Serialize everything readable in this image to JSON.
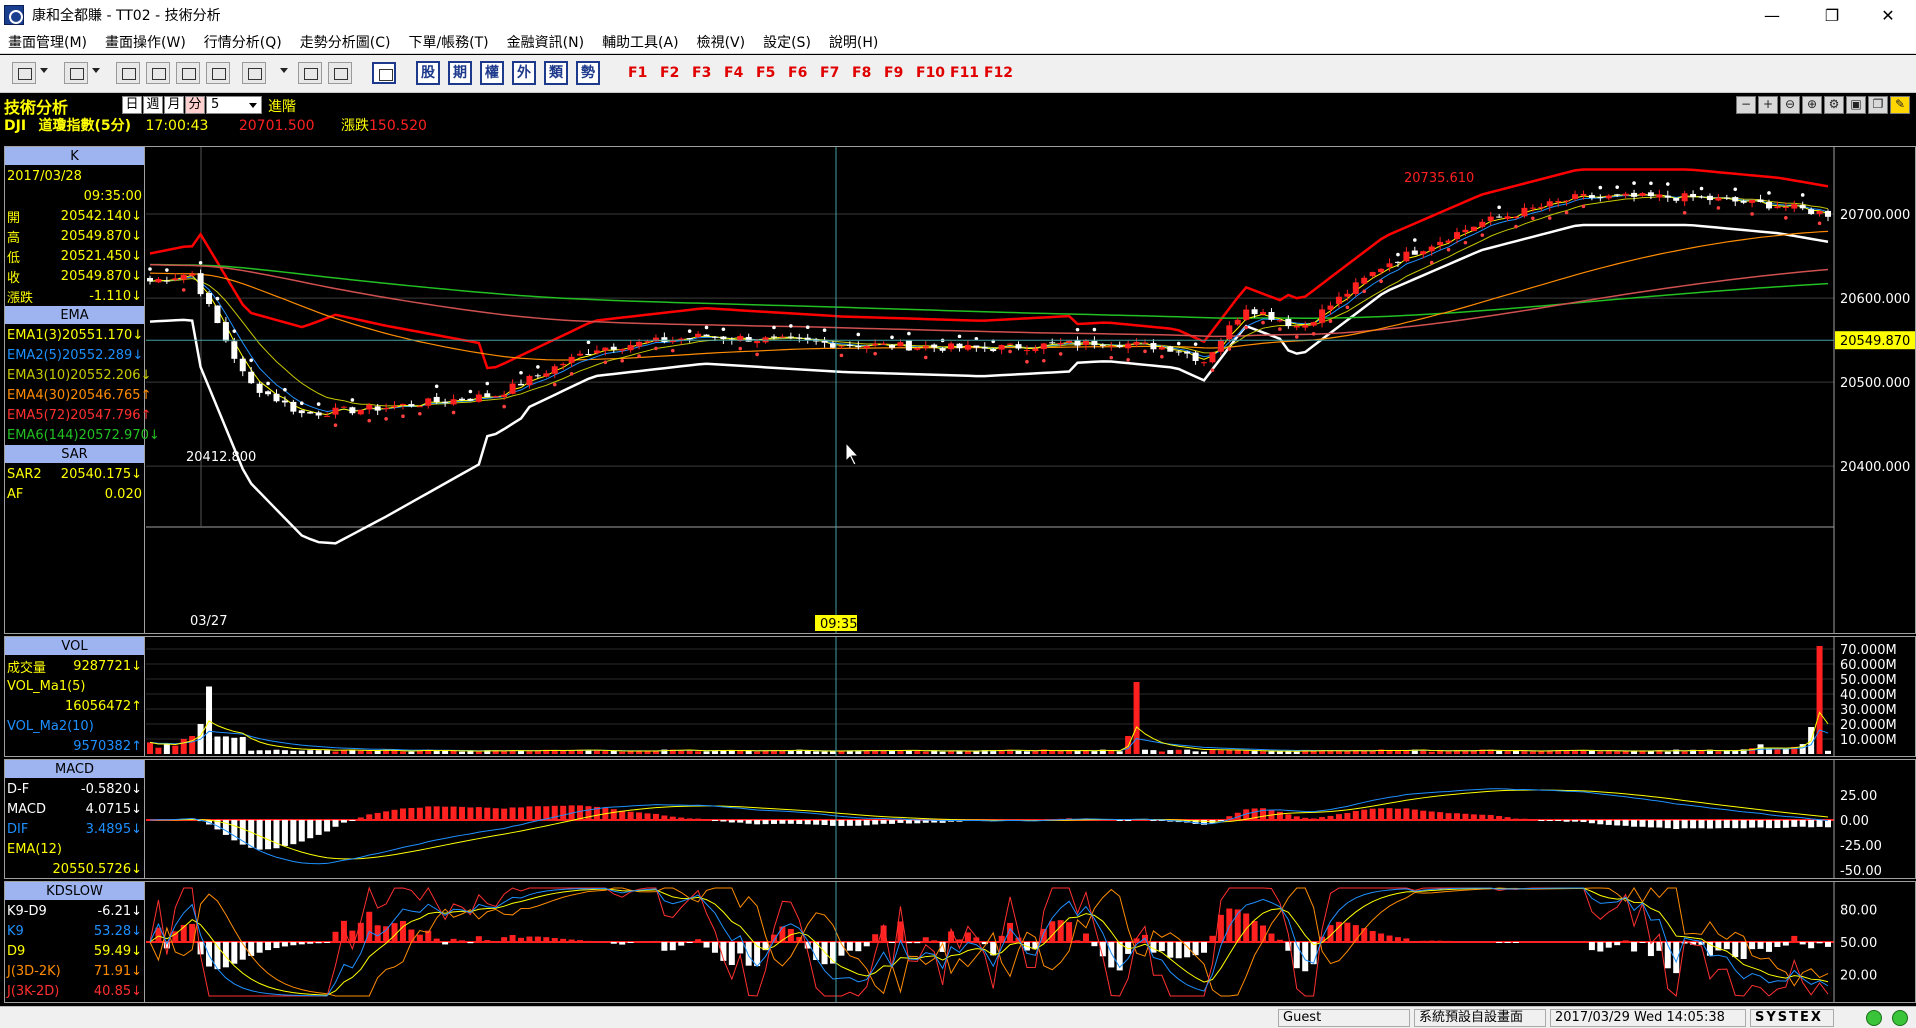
{
  "window": {
    "title": "康和全都賺 - TT02 - 技術分析",
    "minimize": "—",
    "maximize": "❐",
    "close": "✕"
  },
  "menu": [
    "畫面管理(M)",
    "畫面操作(W)",
    "行情分析(Q)",
    "走勢分析圖(C)",
    "下單/帳務(T)",
    "金融資訊(N)",
    "輔助工具(A)",
    "檢視(V)",
    "設定(S)",
    "說明(H)"
  ],
  "toolbar": {
    "blue_buttons": [
      "股",
      "期",
      "權",
      "外",
      "類",
      "勢"
    ],
    "fkeys": [
      "F1",
      "F2",
      "F3",
      "F4",
      "F5",
      "F6",
      "F7",
      "F8",
      "F9",
      "F10",
      "F11",
      "F12"
    ]
  },
  "header": {
    "title": "技術分析",
    "periods": [
      "日",
      "週",
      "月",
      "分"
    ],
    "active_period": "分",
    "interval": "5",
    "advanced": "進階",
    "symbol": "DJI",
    "name": "道瓊指數(5分)",
    "time": "17:00:43",
    "last": "20701.500",
    "change_label": "漲跌",
    "change": "150.520"
  },
  "k_panel": {
    "title": "K",
    "date": "2017/03/28",
    "time": "09:35:00",
    "rows": [
      {
        "label": "開",
        "value": "20542.140↓"
      },
      {
        "label": "高",
        "value": "20549.870↓"
      },
      {
        "label": "低",
        "value": "20521.450↓"
      },
      {
        "label": "收",
        "value": "20549.870↓"
      },
      {
        "label": "漲跌",
        "value": "-1.110↓"
      }
    ],
    "ema_title": "EMA",
    "ema": [
      {
        "label": "EMA1(3)",
        "value": "20551.170↓",
        "color": "#ffff00"
      },
      {
        "label": "EMA2(5)",
        "value": "20552.289↓",
        "color": "#1e90ff"
      },
      {
        "label": "EMA3(10)",
        "value": "20552.206↓",
        "color": "#c8c800"
      },
      {
        "label": "EMA4(30)",
        "value": "20546.765↑",
        "color": "#ff8c00"
      },
      {
        "label": "EMA5(72)",
        "value": "20547.796↑",
        "color": "#ff3030"
      },
      {
        "label": "EMA6(144)",
        "value": "20572.970↓",
        "color": "#22c022"
      }
    ],
    "sar_title": "SAR",
    "sar": [
      {
        "label": "SAR2",
        "value": "20540.175↓"
      },
      {
        "label": "AF",
        "value": "0.020"
      }
    ],
    "high_label": "20735.610",
    "low_label": "20412.800",
    "current_price": "20549.870",
    "axis_labels": [
      "20700.000",
      "20600.000",
      "20500.000",
      "20400.000"
    ],
    "date_marker": "03/27",
    "cursor_time": "09:35"
  },
  "vol_panel": {
    "title": "VOL",
    "rows": [
      {
        "label": "成交量",
        "value": "9287721↓"
      },
      {
        "label": "VOL_Ma1(5)",
        "value": ""
      },
      {
        "label": "",
        "value": "16056472↑"
      },
      {
        "label": "VOL_Ma2(10)",
        "value": ""
      },
      {
        "label": "",
        "value": "9570382↑"
      }
    ],
    "axis_labels": [
      "70.000M",
      "60.000M",
      "50.000M",
      "40.000M",
      "30.000M",
      "20.000M",
      "10.000M"
    ]
  },
  "macd_panel": {
    "title": "MACD",
    "rows": [
      {
        "label": "D-F",
        "value": "-0.5820↓"
      },
      {
        "label": "MACD",
        "value": "4.0715↓"
      },
      {
        "label": "DIF",
        "value": "3.4895↓"
      },
      {
        "label": "EMA(12)",
        "value": ""
      },
      {
        "label": "",
        "value": "20550.5726↓"
      }
    ],
    "axis_labels": [
      "25.00",
      "0.00",
      "-25.00",
      "-50.00"
    ]
  },
  "kd_panel": {
    "title": "KDSLOW",
    "rows": [
      {
        "label": "K9-D9",
        "value": "-6.21↓"
      },
      {
        "label": "K9",
        "value": "53.28↓"
      },
      {
        "label": "D9",
        "value": "59.49↓"
      },
      {
        "label": "J(3D-2K)",
        "value": "71.91↓"
      },
      {
        "label": "J(3K-2D)",
        "value": "40.85↓"
      }
    ],
    "axis_labels": [
      "80.00",
      "50.00",
      "20.00"
    ]
  },
  "status": {
    "user": "Guest",
    "layout": "系統預設自設畫面",
    "datetime": "2017/03/29 Wed 14:05:38",
    "brand": "SYSTEX"
  },
  "colors": {
    "up": "#ff2020",
    "down": "#ffffff",
    "bollinger_upper": "#ff0000",
    "bollinger_lower": "#ffffff",
    "grid": "#444444",
    "cursor": "#44a0a0"
  }
}
